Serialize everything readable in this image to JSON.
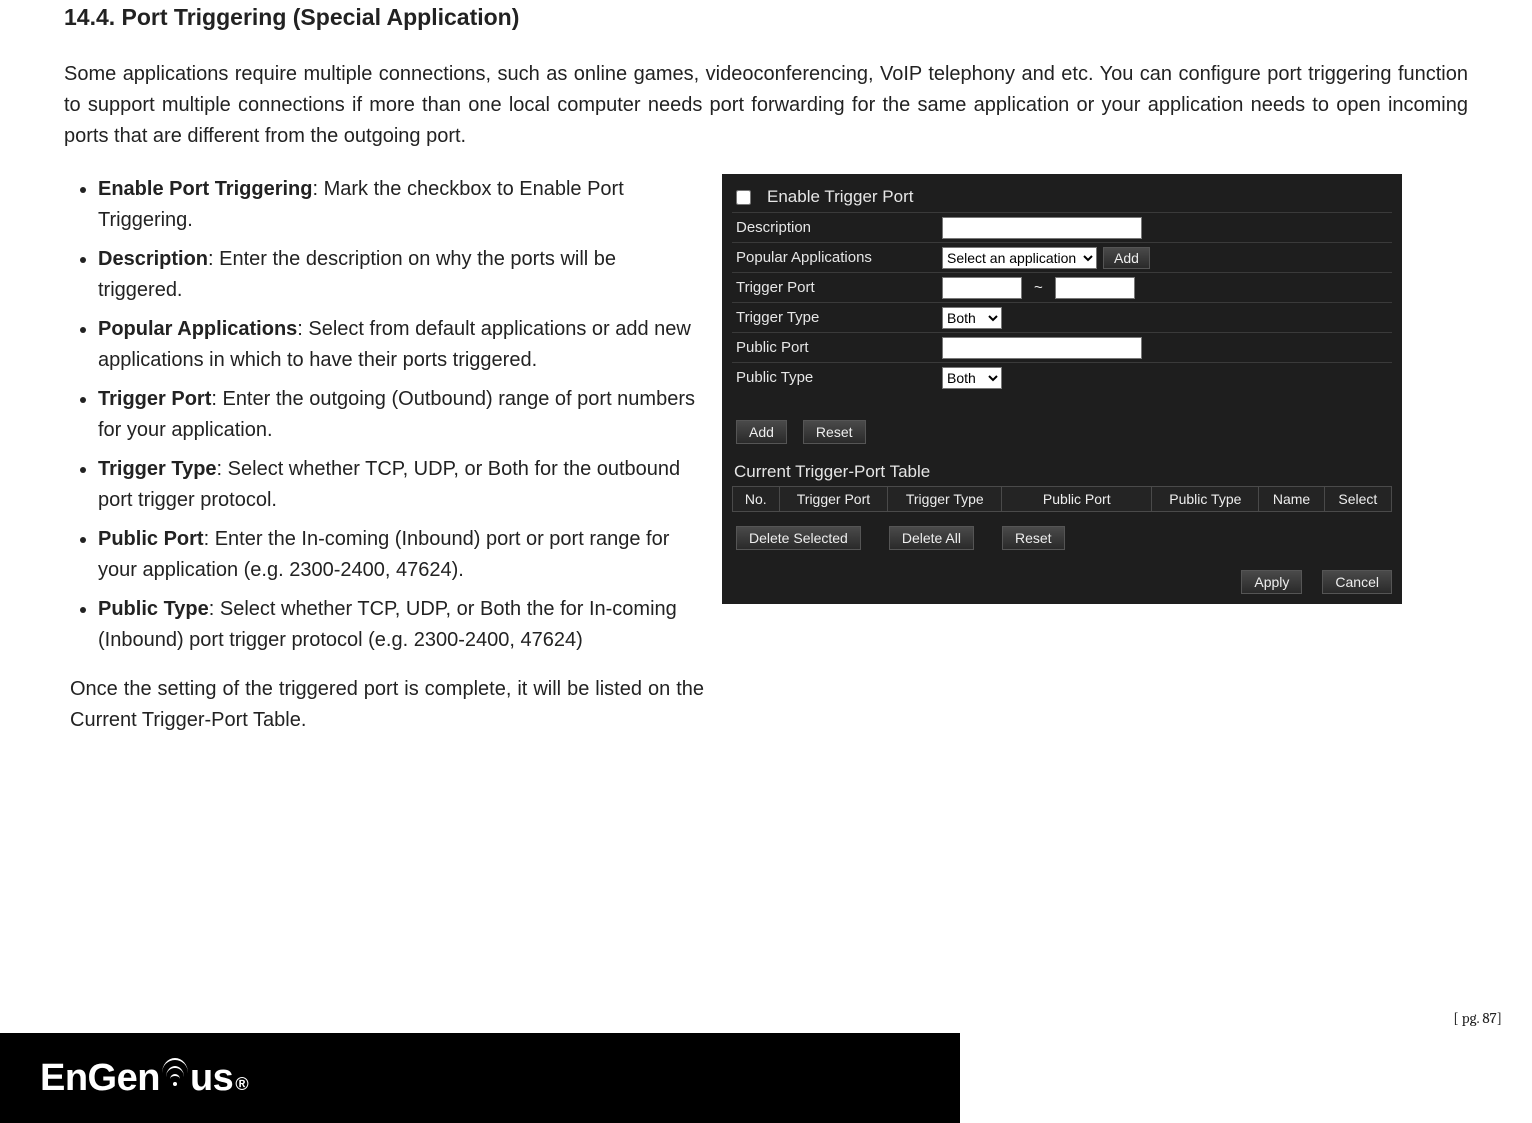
{
  "section_title": "14.4.  Port Triggering (Special Application)",
  "intro": "Some applications require multiple connections, such as online games, videoconferencing, VoIP telephony and etc. You can configure port triggering function to support multiple connections if more than one local computer needs port forwarding for the same application or your application needs to open incoming ports that are different from the outgoing port.",
  "bullets": [
    {
      "b": "Enable Port Triggering",
      "t": ": Mark the checkbox to Enable Port Triggering."
    },
    {
      "b": "Description",
      "t": ": Enter the description on why the ports will be triggered."
    },
    {
      "b": "Popular Applications",
      "t": ": Select from default applications or add new applications in which to have their ports triggered."
    },
    {
      "b": "Trigger Port",
      "t": ": Enter the outgoing (Outbound) range of port numbers for your application."
    },
    {
      "b": "Trigger Type",
      "t": ": Select whether TCP, UDP, or Both for the outbound port trigger protocol."
    },
    {
      "b": "Public Port",
      "t": ": Enter the In-coming (Inbound) port or port range for your application (e.g. 2300-2400, 47624)."
    },
    {
      "b": "Public Type",
      "t": ": Select whether TCP, UDP, or Both the for In-coming (Inbound) port trigger protocol (e.g. 2300-2400, 47624)"
    }
  ],
  "closing": "Once the setting of the triggered port is complete, it will be listed on the Current Trigger-Port Table.",
  "panel": {
    "enable_label": "Enable Trigger Port",
    "rows": {
      "description": "Description",
      "popular": "Popular Applications",
      "trigger_port": "Trigger Port",
      "trigger_type": "Trigger Type",
      "public_port": "Public Port",
      "public_type": "Public Type"
    },
    "select_app": "Select an application",
    "both": "Both",
    "tilde": "~",
    "btn_add": "Add",
    "btn_reset": "Reset",
    "btn_delete_selected": "Delete Selected",
    "btn_delete_all": "Delete All",
    "btn_apply": "Apply",
    "btn_cancel": "Cancel",
    "table_title": "Current Trigger-Port Table",
    "table_headers": [
      "No.",
      "Trigger Port",
      "Trigger Type",
      "Public Port",
      "Public Type",
      "Name",
      "Select"
    ]
  },
  "footer": {
    "brand_pre": "EnGen",
    "brand_post": "us",
    "reg": "®"
  },
  "page_number": "[ pg. 87]"
}
